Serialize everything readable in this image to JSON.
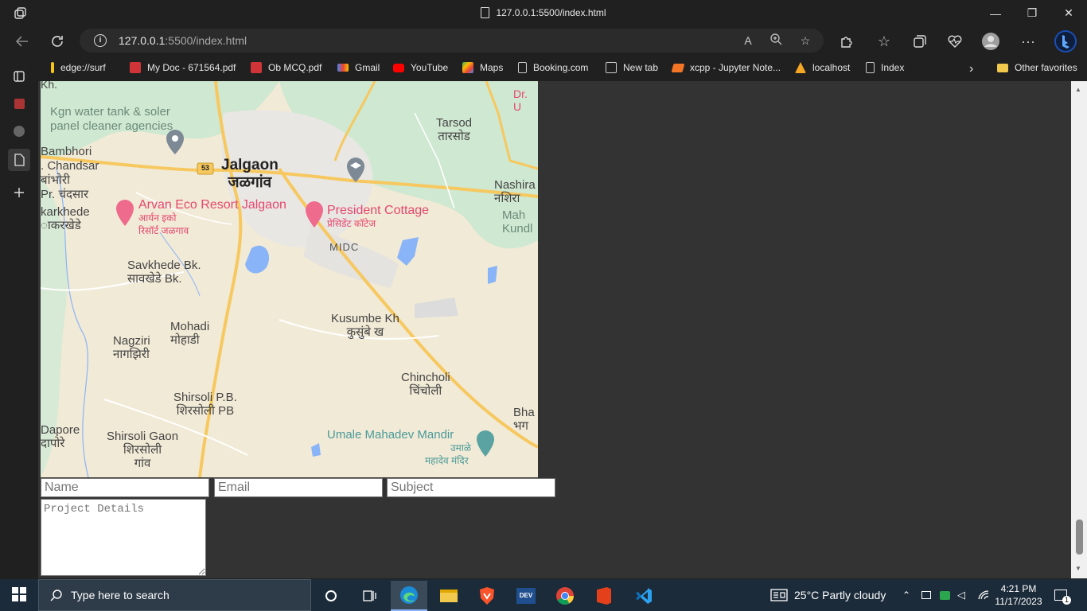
{
  "window": {
    "title": "127.0.0.1:5500/index.html",
    "minimize": "—",
    "restore": "❐",
    "close": "✕"
  },
  "toolbar": {
    "url_host": "127.0.0.1",
    "url_rest": ":5500/index.html",
    "icons": [
      "back-icon",
      "refresh-icon",
      "read-aloud-icon",
      "zoom-icon",
      "add-favorite-icon",
      "extensions-icon",
      "favorites-icon",
      "collections-icon",
      "browser-essentials-icon",
      "profile-icon",
      "more-icon",
      "bing-icon"
    ],
    "more_label": "···"
  },
  "favorites": [
    {
      "label": "edge://surf",
      "icon": "surf-icon",
      "color": "#2f6fd6"
    },
    {
      "label": "My Doc - 671564.pdf",
      "icon": "pdf-icon",
      "color": "#d13438"
    },
    {
      "label": "Ob MCQ.pdf",
      "icon": "pdf-icon",
      "color": "#d13438"
    },
    {
      "label": "Gmail",
      "icon": "gmail-icon",
      "color": "#ea4335"
    },
    {
      "label": "YouTube",
      "icon": "youtube-icon",
      "color": "#ff0000"
    },
    {
      "label": "Maps",
      "icon": "maps-icon",
      "color": "#34a853"
    },
    {
      "label": "Booking.com",
      "icon": "page-icon",
      "color": "#cccccc"
    },
    {
      "label": "New tab",
      "icon": "newtab-icon",
      "color": "#cccccc"
    },
    {
      "label": "xcpp - Jupyter Note...",
      "icon": "jupyter-icon",
      "color": "#f37626"
    },
    {
      "label": "localhost",
      "icon": "xampp-icon",
      "color": "#f5a623"
    },
    {
      "label": "Index",
      "icon": "page-icon",
      "color": "#cccccc"
    },
    {
      "label": "Other favorites",
      "icon": "folder-icon",
      "color": "#f2c94c"
    }
  ],
  "map": {
    "labels": [
      {
        "text": "Kgn water tank & soler",
        "cls": "poi"
      },
      {
        "text": "panel cleaner agencies",
        "cls": "poi"
      },
      {
        "text": "Tarsod",
        "cls": "town"
      },
      {
        "text": "तारसोड",
        "cls": "town"
      },
      {
        "text": "Bambhori",
        "cls": "town"
      },
      {
        "text": ". Chandsar",
        "cls": "town"
      },
      {
        "text": "बांभोरी",
        "cls": "town"
      },
      {
        "text": "Pr. चंदसार",
        "cls": "town"
      },
      {
        "text": "Jalgaon",
        "cls": "city"
      },
      {
        "text": "जळगांव",
        "cls": "city"
      },
      {
        "text": "53",
        "cls": "shield"
      },
      {
        "text": "Nashira",
        "cls": "town"
      },
      {
        "text": "नशिरा",
        "cls": "town"
      },
      {
        "text": "karkhede",
        "cls": "town"
      },
      {
        "text": "ाकरखेडे",
        "cls": "town"
      },
      {
        "text": "Arvan Eco Resort Jalgaon",
        "cls": "pink"
      },
      {
        "text": "आर्यन इको",
        "cls": "pinksm"
      },
      {
        "text": "रिसॉर्ट जळगाव",
        "cls": "pinksm"
      },
      {
        "text": "President Cottage",
        "cls": "pink"
      },
      {
        "text": "प्रेसिडेंट कॉटेज",
        "cls": "pinksm"
      },
      {
        "text": "Mah",
        "cls": "town"
      },
      {
        "text": "Kundl",
        "cls": "town"
      },
      {
        "text": "MIDC",
        "cls": "area"
      },
      {
        "text": "Savkhede Bk.",
        "cls": "town"
      },
      {
        "text": "सावखेडे Bk.",
        "cls": "town"
      },
      {
        "text": "Mohadi",
        "cls": "town"
      },
      {
        "text": "मोहाडी",
        "cls": "town"
      },
      {
        "text": "Kusumbe Kh",
        "cls": "town"
      },
      {
        "text": "कुसुंबे ख",
        "cls": "town"
      },
      {
        "text": "Nagziri",
        "cls": "town"
      },
      {
        "text": "नागझिरी",
        "cls": "town"
      },
      {
        "text": "Chincholi",
        "cls": "town"
      },
      {
        "text": "चिंचोली",
        "cls": "town"
      },
      {
        "text": "Shirsoli P.B.",
        "cls": "town"
      },
      {
        "text": "शिरसोली PB",
        "cls": "town"
      },
      {
        "text": "Bha",
        "cls": "town"
      },
      {
        "text": "भग",
        "cls": "town"
      },
      {
        "text": "Dapore",
        "cls": "town"
      },
      {
        "text": "दापोरे",
        "cls": "town"
      },
      {
        "text": "Shirsoli Gaon",
        "cls": "town"
      },
      {
        "text": "शिरसोली",
        "cls": "town"
      },
      {
        "text": "गांव",
        "cls": "town"
      },
      {
        "text": "Umale Mahadev Mandir",
        "cls": "teal"
      },
      {
        "text": "उमाळे",
        "cls": "tealsm"
      },
      {
        "text": "महादेव मंदिर",
        "cls": "tealsm"
      },
      {
        "text": "Dr. U",
        "cls": "pinksm"
      },
      {
        "text": "Kh.",
        "cls": "town"
      }
    ]
  },
  "form": {
    "name_placeholder": "Name",
    "email_placeholder": "Email",
    "subject_placeholder": "Subject",
    "details_placeholder": "Project Details"
  },
  "taskbar": {
    "search_placeholder": "Type here to search",
    "apps": [
      "task-view-icon",
      "widgets-icon",
      "edge-icon",
      "file-explorer-icon",
      "brave-icon",
      "dev-icon",
      "chrome-icon",
      "office-icon",
      "vscode-icon"
    ],
    "weather": "25°C  Partly cloudy",
    "time": "4:21 PM",
    "date": "11/17/2023",
    "notification_count": "1"
  }
}
